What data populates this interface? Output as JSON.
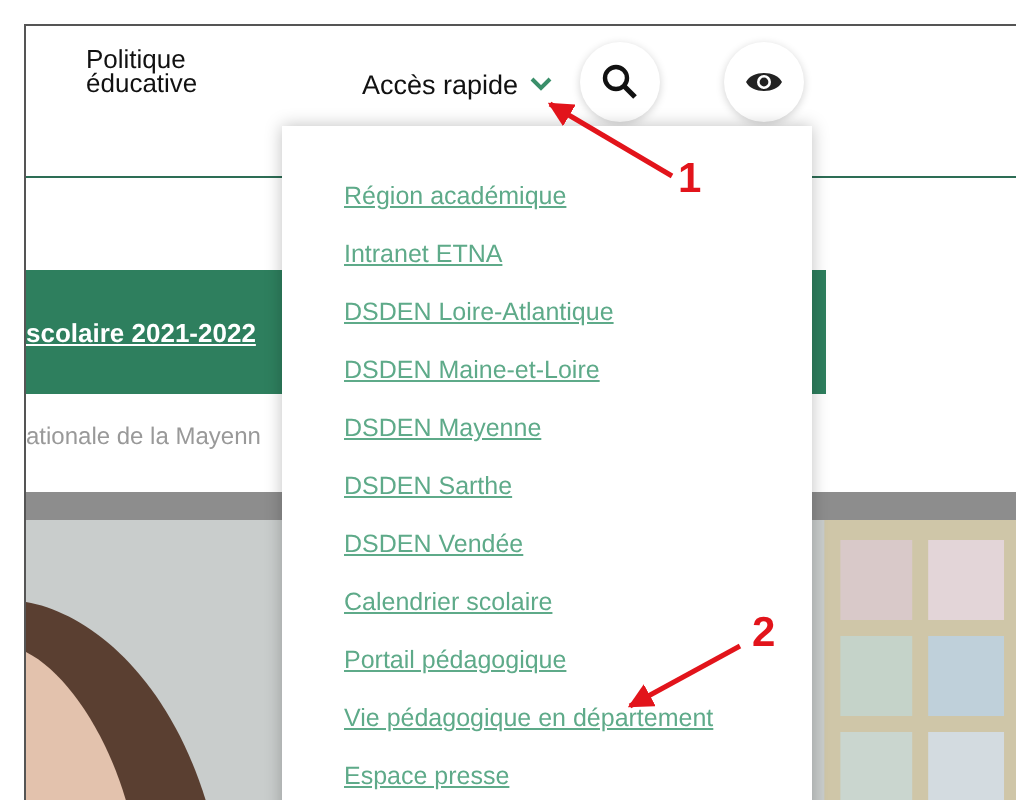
{
  "header": {
    "title": "Politique éducative",
    "quick_access": {
      "label": "Accès rapide",
      "expanded": true
    }
  },
  "banner": {
    "text": "scolaire 2021-2022"
  },
  "subtitle": "ationale de la Mayenn",
  "quick_menu": {
    "items": [
      {
        "label": "Région académique"
      },
      {
        "label": "Intranet ETNA"
      },
      {
        "label": "DSDEN Loire-Atlantique"
      },
      {
        "label": "DSDEN Maine-et-Loire"
      },
      {
        "label": "DSDEN Mayenne"
      },
      {
        "label": "DSDEN Sarthe"
      },
      {
        "label": "DSDEN Vendée"
      },
      {
        "label": "Calendrier scolaire"
      },
      {
        "label": "Portail pédagogique"
      },
      {
        "label": "Vie pédagogique en département"
      },
      {
        "label": "Espace presse"
      }
    ]
  },
  "annotations": [
    {
      "label": "1"
    },
    {
      "label": "2"
    }
  ]
}
